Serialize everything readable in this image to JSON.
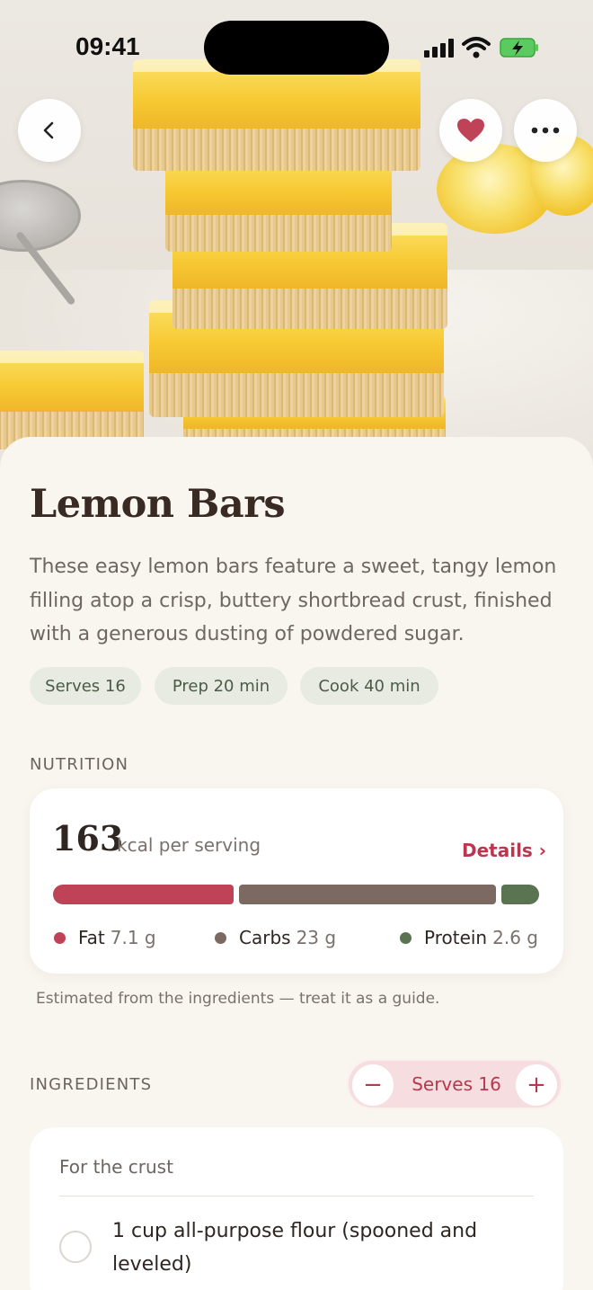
{
  "status_bar": {
    "time": "09:41"
  },
  "recipe": {
    "title": "Lemon Bars",
    "description": "These easy lemon bars feature a sweet, tangy lemon filling atop a crisp, buttery shortbread crust, finished with a generous dusting of powdered sugar.",
    "chips": [
      "Serves 16",
      "Prep 20 min",
      "Cook 40 min"
    ]
  },
  "nutrition": {
    "section_label": "NUTRITION",
    "kcal": "163",
    "kcal_unit": "kcal per serving",
    "details_label": "Details ›",
    "macros": [
      {
        "name": "Fat",
        "value": "7.1 g",
        "color": "#bf4257",
        "fraction": 0.38
      },
      {
        "name": "Carbs",
        "value": "23 g",
        "color": "#7c6a62",
        "fraction": 0.54
      },
      {
        "name": "Protein",
        "value": "2.6 g",
        "color": "#5a7452",
        "fraction": 0.08
      }
    ],
    "note": "Estimated from the ingredients — treat it as a guide."
  },
  "ingredients": {
    "section_label": "INGREDIENTS",
    "serves_label": "Serves 16",
    "minus": "−",
    "plus": "+",
    "group_title": "For the crust",
    "items": [
      "1 cup all-purpose flour (spooned and leveled)"
    ]
  },
  "icons": {
    "back": "chevron-left-icon",
    "favorite": "heart-icon",
    "more": "more-horizontal-icon"
  },
  "colors": {
    "accent": "#b8384f",
    "chip_bg": "#e8ebe1",
    "sheet_bg": "#f9f5ef"
  }
}
